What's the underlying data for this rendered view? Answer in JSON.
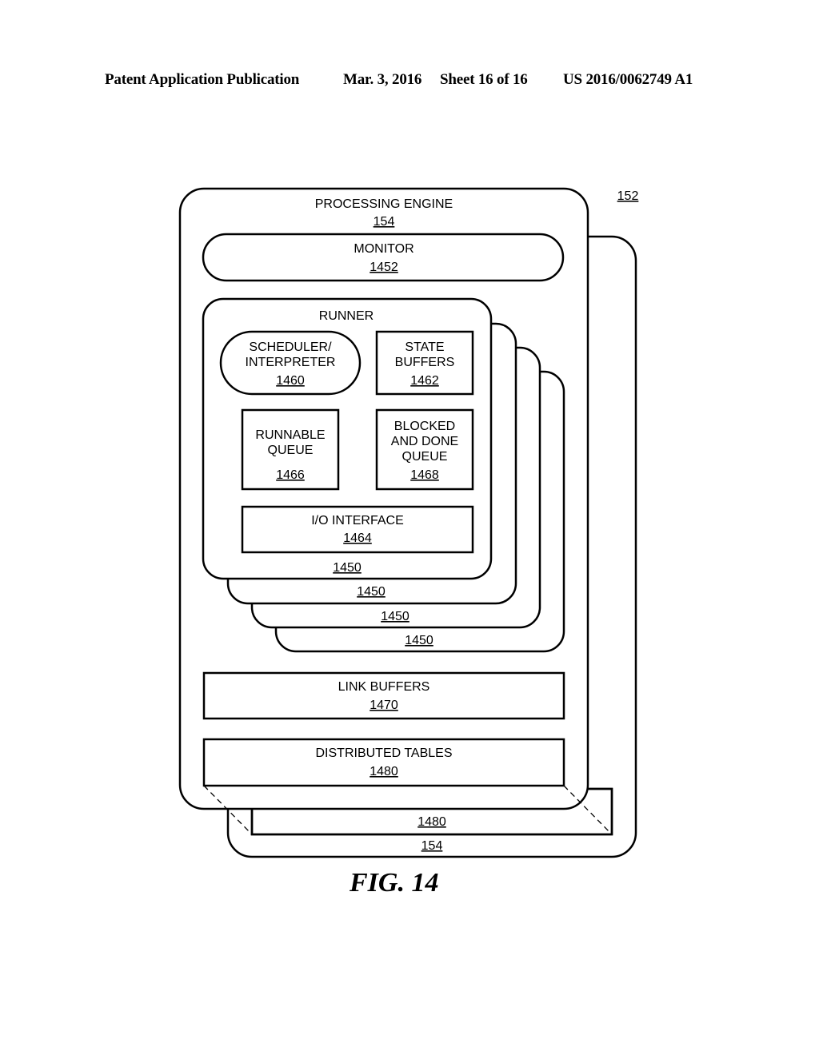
{
  "header": {
    "publication": "Patent Application Publication",
    "date": "Mar. 3, 2016",
    "sheet": "Sheet 16 of 16",
    "number": "US 2016/0062749 A1"
  },
  "diagram": {
    "outer_ref": "152",
    "processing_engine": {
      "label": "PROCESSING ENGINE",
      "ref": "154"
    },
    "monitor": {
      "label": "MONITOR",
      "ref": "1452"
    },
    "runner": {
      "label": "RUNNER",
      "ref": "1450",
      "scheduler": {
        "line1": "SCHEDULER/",
        "line2": "INTERPRETER",
        "ref": "1460"
      },
      "state_buffers": {
        "line1": "STATE",
        "line2": "BUFFERS",
        "ref": "1462"
      },
      "runnable_queue": {
        "line1": "RUNNABLE",
        "line2": "QUEUE",
        "ref": "1466"
      },
      "blocked_queue": {
        "line1": "BLOCKED",
        "line2": "AND DONE",
        "line3": "QUEUE",
        "ref": "1468"
      },
      "io_interface": {
        "label": "I/O INTERFACE",
        "ref": "1464"
      }
    },
    "runner_stack_refs": [
      "1450",
      "1450",
      "1450"
    ],
    "link_buffers": {
      "label": "LINK BUFFERS",
      "ref": "1470"
    },
    "distributed_tables": {
      "label": "DISTRIBUTED TABLES",
      "ref": "1480"
    },
    "back_distributed_tables_ref": "1480",
    "back_engine_ref": "154"
  },
  "caption": "FIG. 14"
}
